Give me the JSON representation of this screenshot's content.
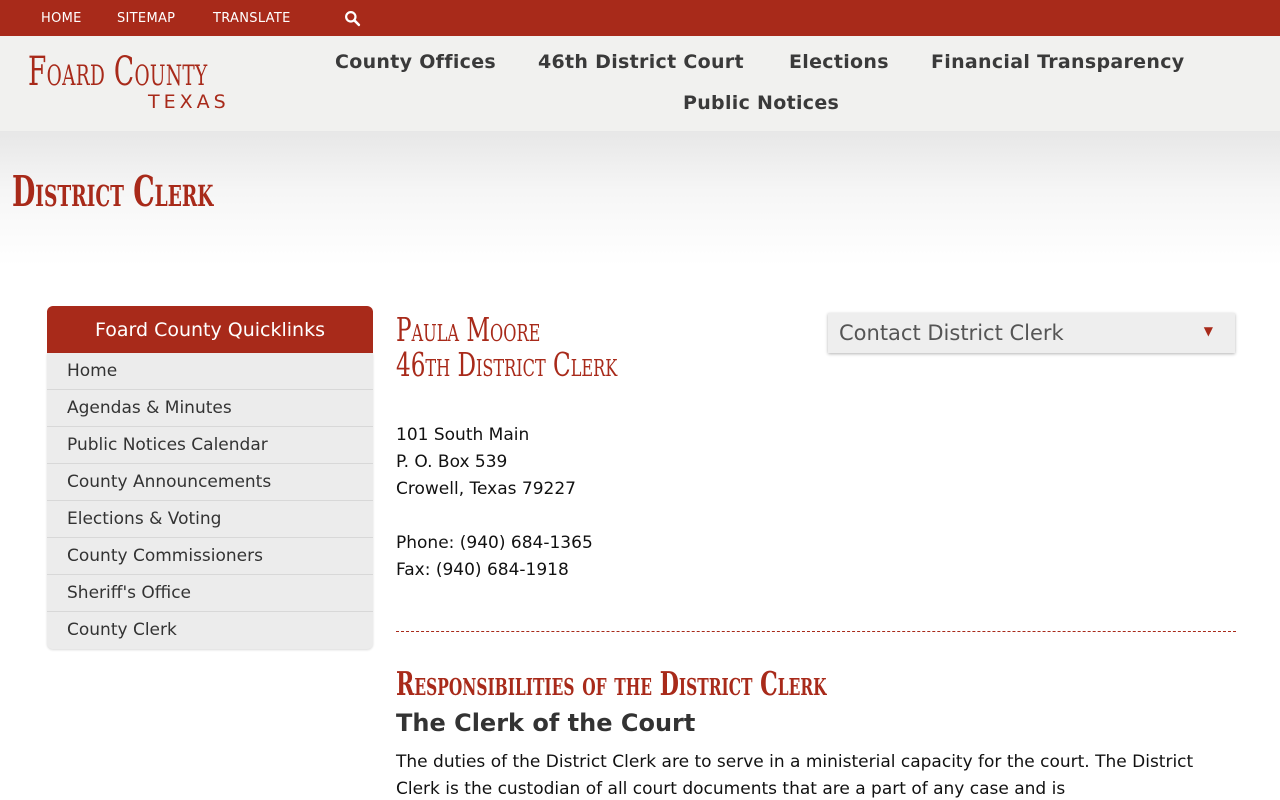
{
  "topbar": {
    "links": [
      "HOME",
      "SITEMAP",
      "TRANSLATE"
    ],
    "search_icon": "search-icon"
  },
  "header": {
    "logo_main": "Foard County",
    "logo_sub": "TEXAS",
    "nav": [
      "County Offices",
      "46th District Court",
      "Elections",
      "Financial Transparency",
      "Public Notices"
    ]
  },
  "banner": {
    "title": "District Clerk"
  },
  "sidebar": {
    "title": "Foard County Quicklinks",
    "items": [
      "Home",
      "Agendas & Minutes",
      "Public Notices Calendar",
      "County Announcements",
      "Elections & Voting",
      "County Commissioners",
      "Sheriff's Office",
      "County Clerk"
    ]
  },
  "contact": {
    "name": "Paula Moore",
    "role": "46th District Clerk",
    "address": [
      "101 South Main",
      "P. O. Box 539",
      "Crowell, Texas 79227"
    ],
    "phone": "Phone: (940) 684-1365",
    "fax": "Fax: (940) 684-1918",
    "dropdown_label": "Contact District Clerk",
    "dropdown_arrow": "▼"
  },
  "section": {
    "title": "Responsibilities of the District Clerk",
    "subtitle": "The Clerk of the Court",
    "paragraph": "The duties of the District Clerk are to serve in a ministerial capacity for the court. The District Clerk is the custodian of all court documents that are a part of any case and is"
  },
  "colors": {
    "brand": "#a82a1a",
    "header_bg": "#f1f1ef",
    "sidebar_bg": "#ececec"
  }
}
